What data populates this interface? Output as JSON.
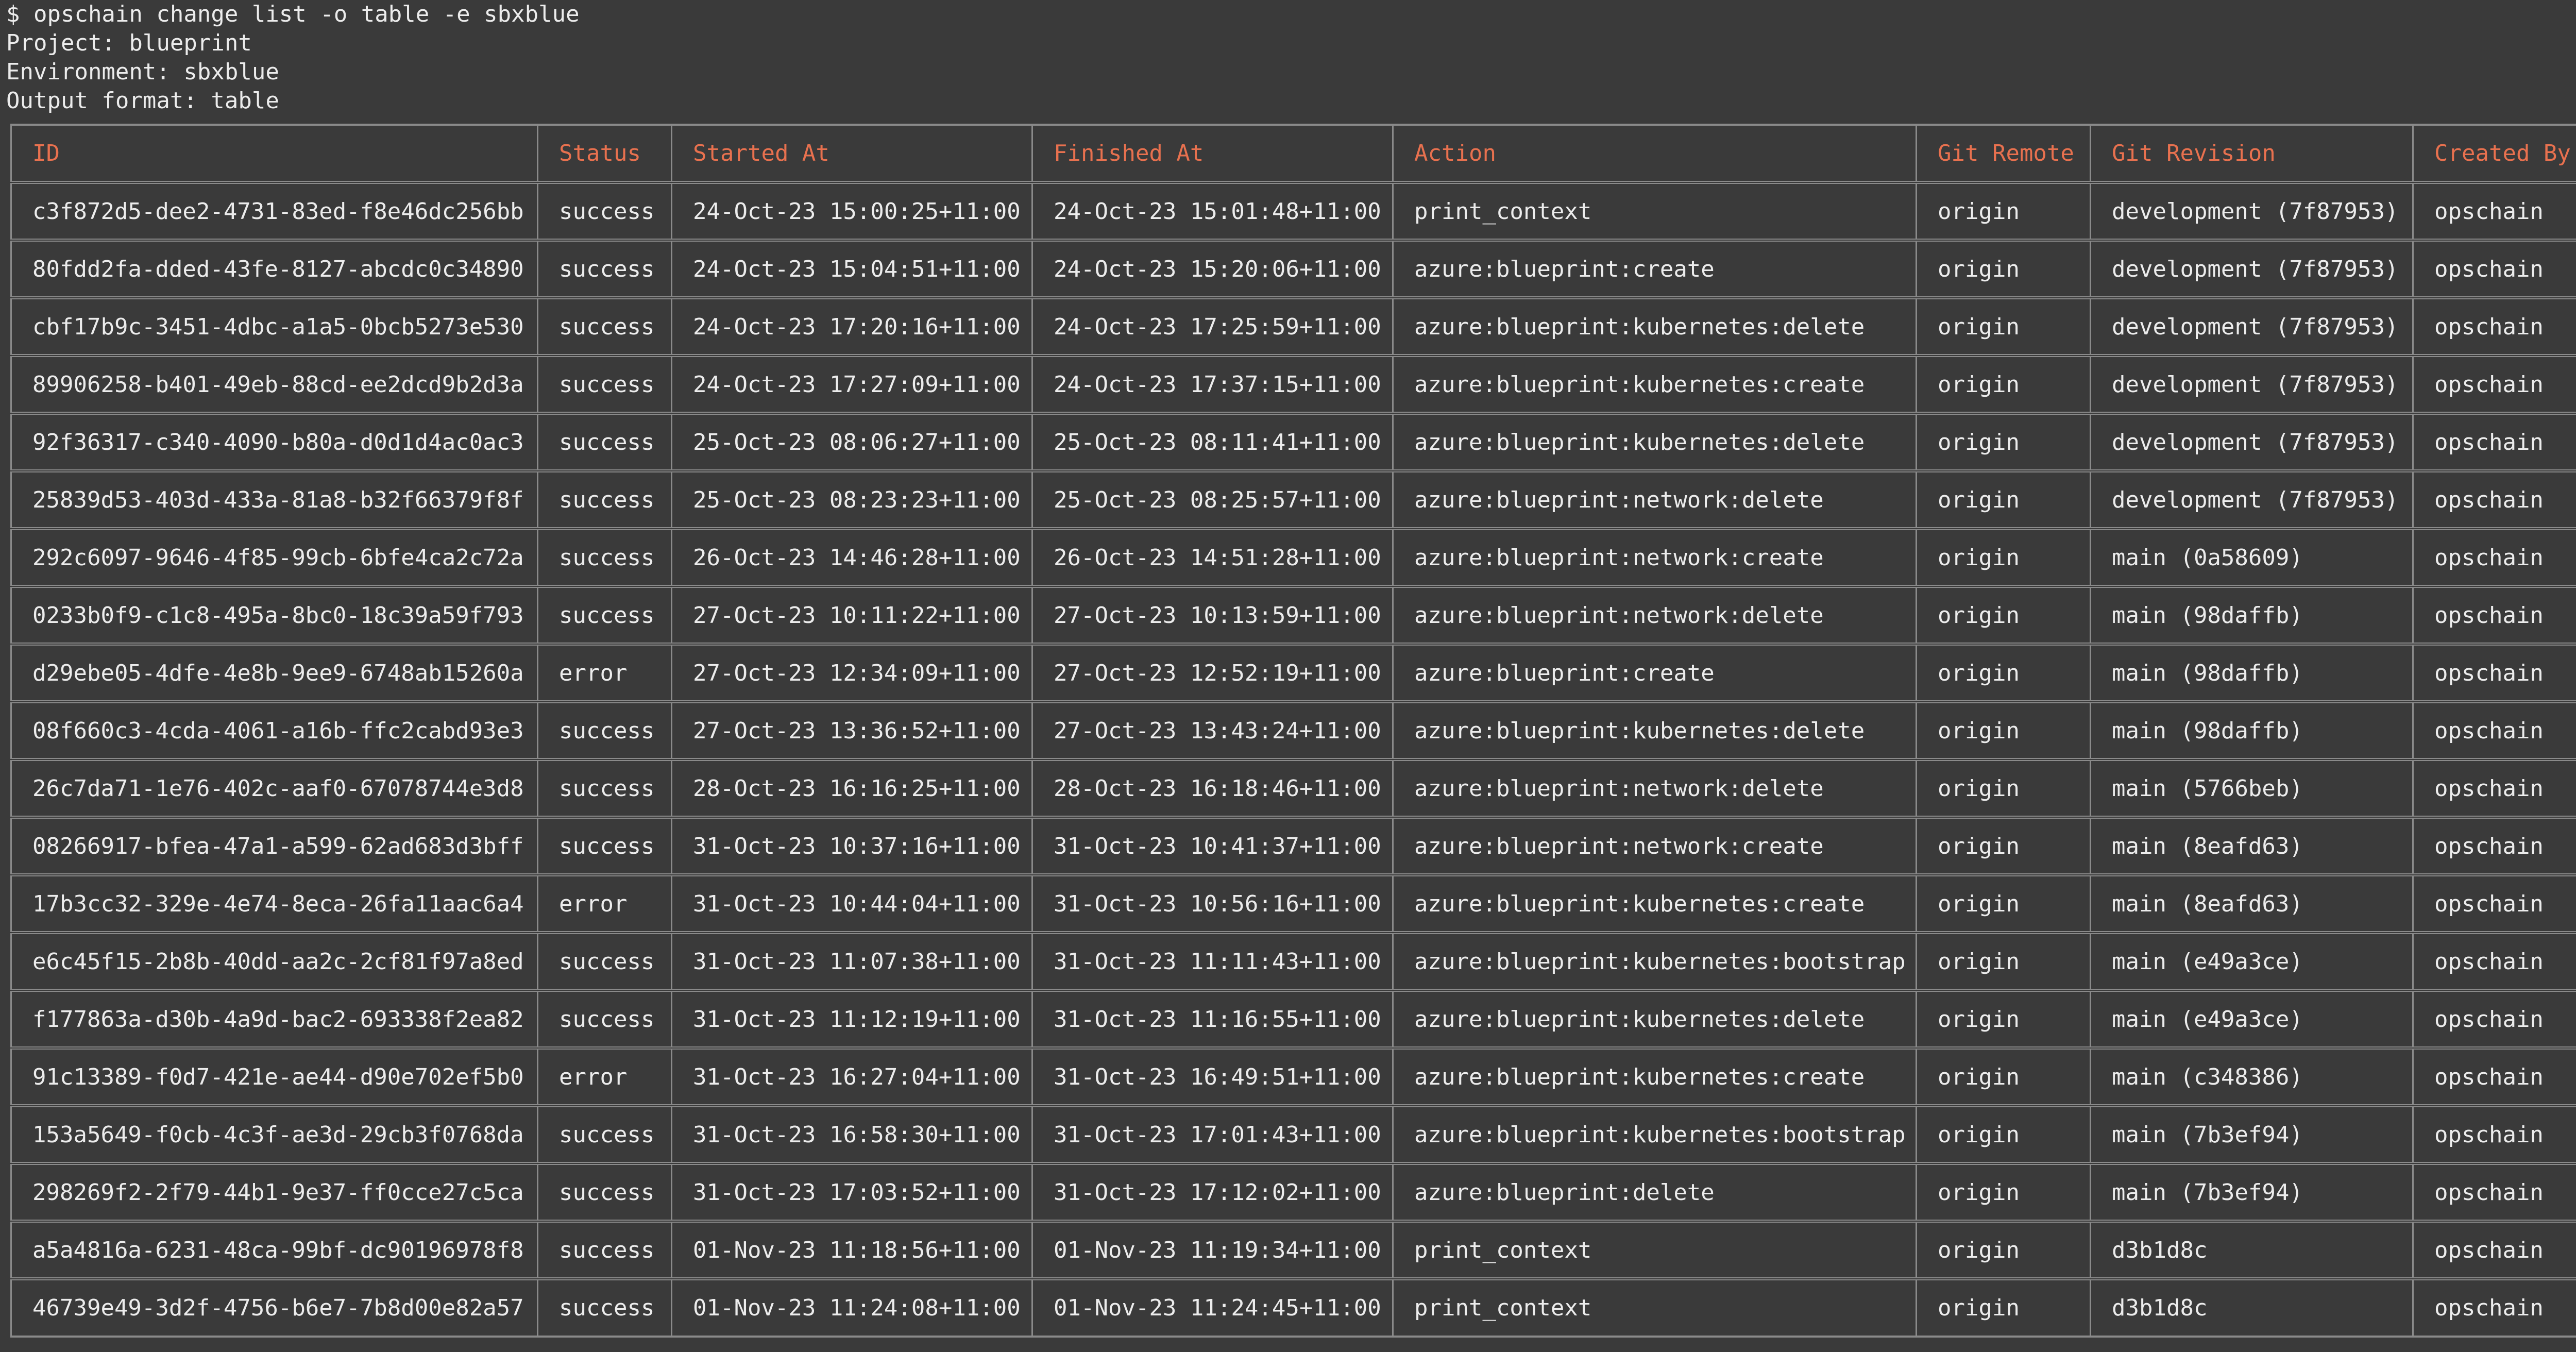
{
  "terminal": {
    "command_line": "$ opschain change list -o table -e sbxblue",
    "project_line": "Project: blueprint",
    "environment_line": "Environment: sbxblue",
    "format_line": "Output format: table"
  },
  "table": {
    "headers": [
      "ID",
      "Status",
      "Started At",
      "Finished At",
      "Action",
      "Git Remote",
      "Git Revision",
      "Created By"
    ],
    "rows": [
      [
        "c3f872d5-dee2-4731-83ed-f8e46dc256bb",
        "success",
        "24-Oct-23 15:00:25+11:00",
        "24-Oct-23 15:01:48+11:00",
        "print_context",
        "origin",
        "development (7f87953)",
        "opschain"
      ],
      [
        "80fdd2fa-dded-43fe-8127-abcdc0c34890",
        "success",
        "24-Oct-23 15:04:51+11:00",
        "24-Oct-23 15:20:06+11:00",
        "azure:blueprint:create",
        "origin",
        "development (7f87953)",
        "opschain"
      ],
      [
        "cbf17b9c-3451-4dbc-a1a5-0bcb5273e530",
        "success",
        "24-Oct-23 17:20:16+11:00",
        "24-Oct-23 17:25:59+11:00",
        "azure:blueprint:kubernetes:delete",
        "origin",
        "development (7f87953)",
        "opschain"
      ],
      [
        "89906258-b401-49eb-88cd-ee2dcd9b2d3a",
        "success",
        "24-Oct-23 17:27:09+11:00",
        "24-Oct-23 17:37:15+11:00",
        "azure:blueprint:kubernetes:create",
        "origin",
        "development (7f87953)",
        "opschain"
      ],
      [
        "92f36317-c340-4090-b80a-d0d1d4ac0ac3",
        "success",
        "25-Oct-23 08:06:27+11:00",
        "25-Oct-23 08:11:41+11:00",
        "azure:blueprint:kubernetes:delete",
        "origin",
        "development (7f87953)",
        "opschain"
      ],
      [
        "25839d53-403d-433a-81a8-b32f66379f8f",
        "success",
        "25-Oct-23 08:23:23+11:00",
        "25-Oct-23 08:25:57+11:00",
        "azure:blueprint:network:delete",
        "origin",
        "development (7f87953)",
        "opschain"
      ],
      [
        "292c6097-9646-4f85-99cb-6bfe4ca2c72a",
        "success",
        "26-Oct-23 14:46:28+11:00",
        "26-Oct-23 14:51:28+11:00",
        "azure:blueprint:network:create",
        "origin",
        "main (0a58609)",
        "opschain"
      ],
      [
        "0233b0f9-c1c8-495a-8bc0-18c39a59f793",
        "success",
        "27-Oct-23 10:11:22+11:00",
        "27-Oct-23 10:13:59+11:00",
        "azure:blueprint:network:delete",
        "origin",
        "main (98daffb)",
        "opschain"
      ],
      [
        "d29ebe05-4dfe-4e8b-9ee9-6748ab15260a",
        "error",
        "27-Oct-23 12:34:09+11:00",
        "27-Oct-23 12:52:19+11:00",
        "azure:blueprint:create",
        "origin",
        "main (98daffb)",
        "opschain"
      ],
      [
        "08f660c3-4cda-4061-a16b-ffc2cabd93e3",
        "success",
        "27-Oct-23 13:36:52+11:00",
        "27-Oct-23 13:43:24+11:00",
        "azure:blueprint:kubernetes:delete",
        "origin",
        "main (98daffb)",
        "opschain"
      ],
      [
        "26c7da71-1e76-402c-aaf0-67078744e3d8",
        "success",
        "28-Oct-23 16:16:25+11:00",
        "28-Oct-23 16:18:46+11:00",
        "azure:blueprint:network:delete",
        "origin",
        "main (5766beb)",
        "opschain"
      ],
      [
        "08266917-bfea-47a1-a599-62ad683d3bff",
        "success",
        "31-Oct-23 10:37:16+11:00",
        "31-Oct-23 10:41:37+11:00",
        "azure:blueprint:network:create",
        "origin",
        "main (8eafd63)",
        "opschain"
      ],
      [
        "17b3cc32-329e-4e74-8eca-26fa11aac6a4",
        "error",
        "31-Oct-23 10:44:04+11:00",
        "31-Oct-23 10:56:16+11:00",
        "azure:blueprint:kubernetes:create",
        "origin",
        "main (8eafd63)",
        "opschain"
      ],
      [
        "e6c45f15-2b8b-40dd-aa2c-2cf81f97a8ed",
        "success",
        "31-Oct-23 11:07:38+11:00",
        "31-Oct-23 11:11:43+11:00",
        "azure:blueprint:kubernetes:bootstrap",
        "origin",
        "main (e49a3ce)",
        "opschain"
      ],
      [
        "f177863a-d30b-4a9d-bac2-693338f2ea82",
        "success",
        "31-Oct-23 11:12:19+11:00",
        "31-Oct-23 11:16:55+11:00",
        "azure:blueprint:kubernetes:delete",
        "origin",
        "main (e49a3ce)",
        "opschain"
      ],
      [
        "91c13389-f0d7-421e-ae44-d90e702ef5b0",
        "error",
        "31-Oct-23 16:27:04+11:00",
        "31-Oct-23 16:49:51+11:00",
        "azure:blueprint:kubernetes:create",
        "origin",
        "main (c348386)",
        "opschain"
      ],
      [
        "153a5649-f0cb-4c3f-ae3d-29cb3f0768da",
        "success",
        "31-Oct-23 16:58:30+11:00",
        "31-Oct-23 17:01:43+11:00",
        "azure:blueprint:kubernetes:bootstrap",
        "origin",
        "main (7b3ef94)",
        "opschain"
      ],
      [
        "298269f2-2f79-44b1-9e37-ff0cce27c5ca",
        "success",
        "31-Oct-23 17:03:52+11:00",
        "31-Oct-23 17:12:02+11:00",
        "azure:blueprint:delete",
        "origin",
        "main (7b3ef94)",
        "opschain"
      ],
      [
        "a5a4816a-6231-48ca-99bf-dc90196978f8",
        "success",
        "01-Nov-23 11:18:56+11:00",
        "01-Nov-23 11:19:34+11:00",
        "print_context",
        "origin",
        "d3b1d8c",
        "opschain"
      ],
      [
        "46739e49-3d2f-4756-b6e7-7b8d00e82a57",
        "success",
        "01-Nov-23 11:24:08+11:00",
        "01-Nov-23 11:24:45+11:00",
        "print_context",
        "origin",
        "d3b1d8c",
        "opschain"
      ]
    ]
  },
  "colors": {
    "background": "#3a3a3a",
    "text": "#ececec",
    "header_text": "#e8714f",
    "border": "#8a8a8a"
  }
}
